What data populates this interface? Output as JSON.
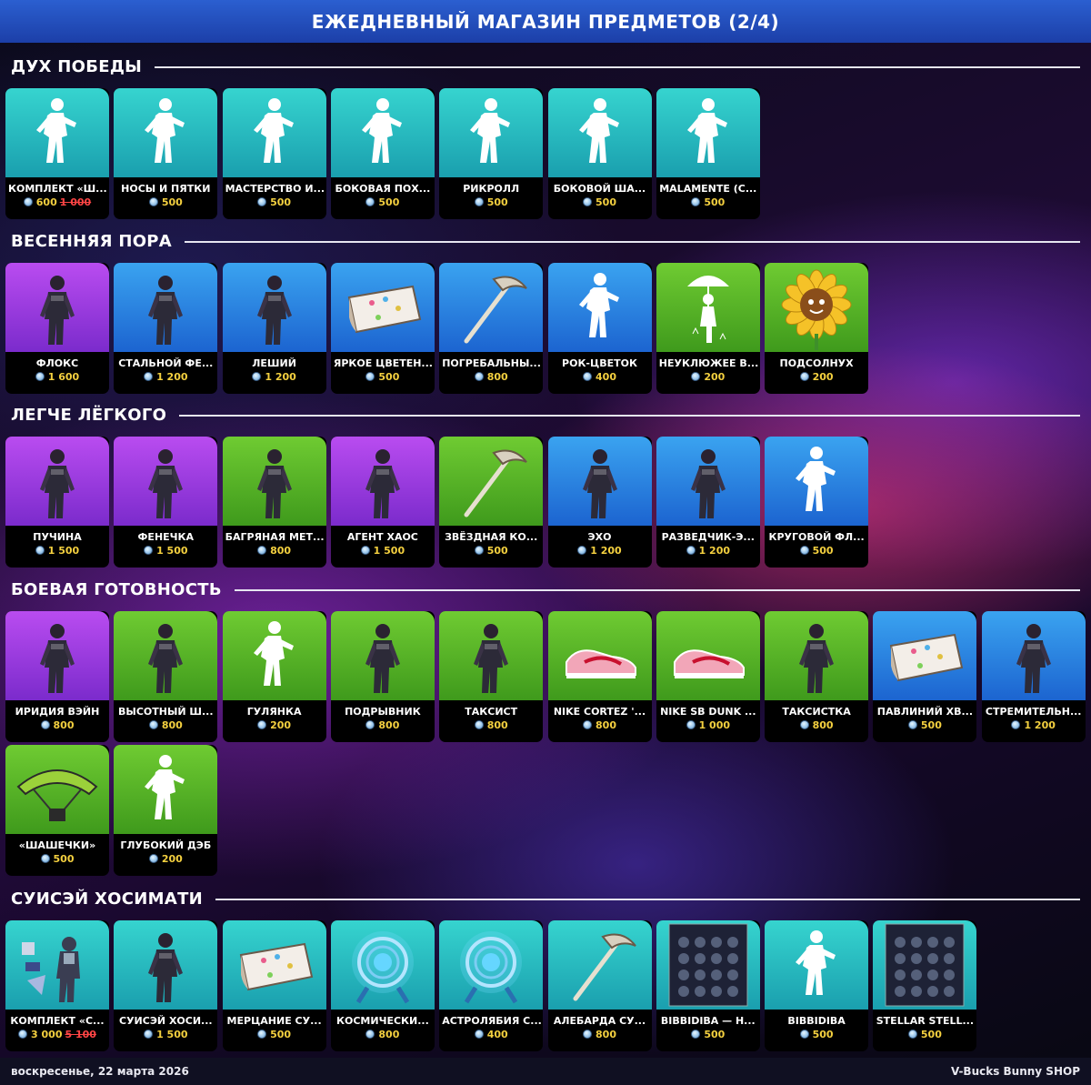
{
  "header": {
    "title": "ЕЖЕДНЕВНЫЙ МАГАЗИН ПРЕДМЕТОВ (2/4)"
  },
  "footer": {
    "date": "воскресенье, 22 марта 2026",
    "brand": "V-Bucks Bunny SHOP"
  },
  "colors": {
    "teal": "#2ec8c4",
    "purple": "#a23ee8",
    "blue": "#2a8de8",
    "green": "#5bbb2a",
    "price": "#f4d03f",
    "old_price": "#ff4545",
    "header_blue": "#1f45b3"
  },
  "sections": [
    {
      "title": "ДУХ ПОБЕДЫ",
      "items": [
        {
          "name": "КОМПЛЕКТ «Ш...",
          "price": "600",
          "old_price": "1 000",
          "rarity": "teal",
          "icon": "emote-dancer-silhouette-icon"
        },
        {
          "name": "НОСЫ И ПЯТКИ",
          "price": "500",
          "rarity": "teal",
          "icon": "emote-dancer-silhouette-icon"
        },
        {
          "name": "МАСТЕРСТВО И...",
          "price": "500",
          "rarity": "teal",
          "icon": "emote-dancer-silhouette-icon"
        },
        {
          "name": "БОКОВАЯ ПОХ...",
          "price": "500",
          "rarity": "teal",
          "icon": "emote-dancer-silhouette-icon"
        },
        {
          "name": "РИКРОЛЛ",
          "price": "500",
          "rarity": "teal",
          "icon": "emote-dancer-silhouette-icon"
        },
        {
          "name": "БОКОВОЙ ША...",
          "price": "500",
          "rarity": "teal",
          "icon": "emote-dancer-silhouette-icon"
        },
        {
          "name": "MALAMENTE (С...",
          "price": "500",
          "rarity": "teal",
          "icon": "emote-dancer-silhouette-icon"
        }
      ]
    },
    {
      "title": "ВЕСЕННЯЯ ПОРА",
      "items": [
        {
          "name": "ФЛОКС",
          "price": "1 600",
          "rarity": "purple",
          "icon": "outfit-character-icon"
        },
        {
          "name": "СТАЛЬНОЙ ФЕ...",
          "price": "1 200",
          "rarity": "blue",
          "icon": "outfit-character-icon"
        },
        {
          "name": "ЛЕШИЙ",
          "price": "1 200",
          "rarity": "blue",
          "icon": "outfit-character-icon"
        },
        {
          "name": "ЯРКОЕ ЦВЕТЕН...",
          "price": "500",
          "rarity": "blue",
          "icon": "wrap-icon"
        },
        {
          "name": "ПОГРЕБАЛЬНЫ...",
          "price": "800",
          "rarity": "blue",
          "icon": "pickaxe-icon"
        },
        {
          "name": "РОК-ЦВЕТОК",
          "price": "400",
          "rarity": "blue",
          "icon": "emote-dancer-silhouette-icon"
        },
        {
          "name": "НЕУКЛЮЖЕЕ В...",
          "price": "200",
          "rarity": "green",
          "icon": "emote-umbrella-silhouette-icon"
        },
        {
          "name": "ПОДСОЛНУХ",
          "price": "200",
          "rarity": "green",
          "icon": "sunflower-emoticon-icon"
        }
      ]
    },
    {
      "title": "ЛЕГЧЕ ЛЁГКОГО",
      "items": [
        {
          "name": "ПУЧИНА",
          "price": "1 500",
          "rarity": "purple",
          "icon": "outfit-character-icon"
        },
        {
          "name": "ФЕНЕЧКА",
          "price": "1 500",
          "rarity": "purple",
          "icon": "outfit-character-icon"
        },
        {
          "name": "БАГРЯНАЯ МЕТ...",
          "price": "800",
          "rarity": "green",
          "icon": "outfit-character-icon"
        },
        {
          "name": "АГЕНТ ХАОС",
          "price": "1 500",
          "rarity": "purple",
          "icon": "outfit-character-icon"
        },
        {
          "name": "ЗВЁЗДНАЯ КО...",
          "price": "500",
          "rarity": "green",
          "icon": "pickaxe-icon"
        },
        {
          "name": "ЭХО",
          "price": "1 200",
          "rarity": "blue",
          "icon": "outfit-character-icon"
        },
        {
          "name": "РАЗВЕДЧИК-Э...",
          "price": "1 200",
          "rarity": "blue",
          "icon": "outfit-character-icon"
        },
        {
          "name": "КРУГОВОЙ ФЛ...",
          "price": "500",
          "rarity": "blue",
          "icon": "emote-dancer-silhouette-icon"
        }
      ]
    },
    {
      "title": "БОЕВАЯ ГОТОВНОСТЬ",
      "items": [
        {
          "name": "ИРИДИЯ ВЭЙН",
          "price": "800",
          "rarity": "purple",
          "icon": "outfit-character-icon"
        },
        {
          "name": "ВЫСОТНЫЙ Ш...",
          "price": "800",
          "rarity": "green",
          "icon": "outfit-character-icon"
        },
        {
          "name": "ГУЛЯНКА",
          "price": "200",
          "rarity": "green",
          "icon": "emote-dancer-silhouette-icon"
        },
        {
          "name": "ПОДРЫВНИК",
          "price": "800",
          "rarity": "green",
          "icon": "outfit-character-icon"
        },
        {
          "name": "ТАКСИСТ",
          "price": "800",
          "rarity": "green",
          "icon": "outfit-character-icon"
        },
        {
          "name": "NIKE CORTEZ '...",
          "price": "800",
          "rarity": "green",
          "icon": "sneaker-icon"
        },
        {
          "name": "NIKE SB DUNK ...",
          "price": "1 000",
          "rarity": "green",
          "icon": "sneaker-icon"
        },
        {
          "name": "ТАКСИСТКА",
          "price": "800",
          "rarity": "green",
          "icon": "outfit-character-icon"
        },
        {
          "name": "ПАВЛИНИЙ ХВ...",
          "price": "500",
          "rarity": "blue",
          "icon": "wrap-icon"
        },
        {
          "name": "СТРЕМИТЕЛЬН...",
          "price": "1 200",
          "rarity": "blue",
          "icon": "outfit-character-icon"
        },
        {
          "name": "«ШАШЕЧКИ»",
          "price": "500",
          "rarity": "green",
          "icon": "glider-icon"
        },
        {
          "name": "ГЛУБОКИЙ ДЭБ",
          "price": "200",
          "rarity": "green",
          "icon": "emote-dancer-silhouette-icon"
        }
      ]
    },
    {
      "title": "СУИСЭЙ ХОСИМАТИ",
      "items": [
        {
          "name": "КОМПЛЕКТ «С...",
          "price": "3 000",
          "old_price": "5 100",
          "rarity": "teal",
          "icon": "bundle-icon"
        },
        {
          "name": "СУИСЭЙ ХОСИ...",
          "price": "1 500",
          "rarity": "teal",
          "icon": "outfit-character-icon"
        },
        {
          "name": "МЕРЦАНИЕ СУ...",
          "price": "500",
          "rarity": "teal",
          "icon": "wrap-icon"
        },
        {
          "name": "КОСМИЧЕСКИ...",
          "price": "800",
          "rarity": "teal",
          "icon": "astrolabe-icon"
        },
        {
          "name": "АСТРОЛЯБИЯ С...",
          "price": "400",
          "rarity": "teal",
          "icon": "astrolabe-icon"
        },
        {
          "name": "АЛЕБАРДА СУ...",
          "price": "800",
          "rarity": "teal",
          "icon": "pickaxe-icon"
        },
        {
          "name": "BIBBIDIBA — Н...",
          "price": "500",
          "rarity": "teal",
          "icon": "album-cover-icon"
        },
        {
          "name": "BIBBIDIBA",
          "price": "500",
          "rarity": "teal",
          "icon": "emote-dancer-silhouette-icon"
        },
        {
          "name": "STELLAR STELL...",
          "price": "500",
          "rarity": "teal",
          "icon": "album-cover-icon"
        }
      ]
    }
  ]
}
